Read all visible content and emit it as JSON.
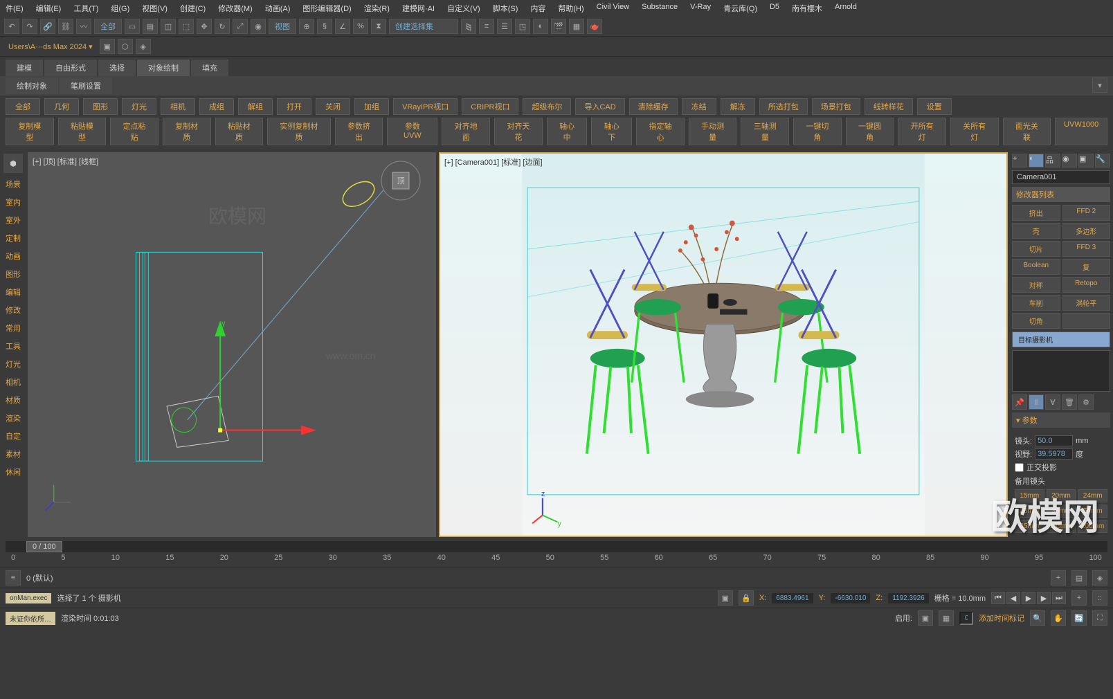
{
  "menu": [
    "件(E)",
    "编辑(E)",
    "工具(T)",
    "组(G)",
    "视图(V)",
    "创建(C)",
    "修改器(M)",
    "动画(A)",
    "图形编辑器(D)",
    "渲染(R)",
    "建模网·AI",
    "自定义(V)",
    "脚本(S)",
    "内容",
    "帮助(H)",
    "Civil View",
    "Substance",
    "V-Ray",
    "青云库(Q)",
    "D5",
    "南有樱木",
    "Arnold"
  ],
  "toolbar": {
    "dropdown": "全部",
    "viewLabel": "视图",
    "selectLabel": "创建选择集"
  },
  "pathbar": "Users\\A···ds Max 2024 ▾",
  "tabs": [
    "建模",
    "自由形式",
    "选择",
    "对象绘制",
    "填充"
  ],
  "subtabs": [
    "绘制对象",
    "笔刷设置"
  ],
  "scriptRows": [
    [
      "全部",
      "几何",
      "图形",
      "灯光",
      "相机",
      "成组",
      "解组",
      "打开",
      "关闭",
      "加组",
      "VRayIPR视口",
      "CRIPR视口",
      "超级布尔",
      "导入CAD",
      "清除缓存",
      "冻结",
      "解冻",
      "所选打包",
      "场景打包",
      "线转样花",
      "设置"
    ],
    [
      "复制模型",
      "粘贴模型",
      "定点粘贴",
      "复制材质",
      "粘贴材质",
      "实例复制材质",
      "参数挤出",
      "参数UVW",
      "对齐地面",
      "对齐天花",
      "轴心中",
      "轴心下",
      "指定轴心",
      "手动测量",
      "三轴测量",
      "一键切角",
      "一键圆角",
      "开所有灯",
      "关所有灯",
      "面光关联",
      "UVW1000"
    ]
  ],
  "sideLabels": [
    "场景",
    "室内",
    "室外",
    "定制",
    "动画",
    "图形",
    "编辑",
    "修改",
    "常用",
    "工具",
    "灯光",
    "相机",
    "材质",
    "渲染",
    "自定",
    "素材",
    "休闲"
  ],
  "viewport": {
    "leftLabel": "[+] [顶] [标准] [线框]",
    "rightLabel": "[+] [Camera001] [标准] [边面]",
    "wm": "欧模网",
    "wmUrl": "www.om.cn"
  },
  "rightPanel": {
    "objName": "Camera001",
    "modList": "修改器列表",
    "btns": [
      [
        "挤出",
        "FFD 2"
      ],
      [
        "壳",
        "多边形"
      ],
      [
        "切片",
        "FFD 3"
      ],
      [
        "Boolean",
        "复"
      ],
      [
        "对称",
        "Retopo"
      ],
      [
        "车削",
        "涡轮平"
      ],
      [
        "切角",
        ""
      ]
    ],
    "modifier": "目标摄影机",
    "paramsTitle": "参数",
    "lensLabel": "镜头:",
    "lensVal": "50.0",
    "lensUnit": "mm",
    "fovLabel": "视野:",
    "fovVal": "39.5978",
    "fovUnit": "度",
    "orthoLabel": "正交投影",
    "stockLabel": "备用镜头",
    "lenses": [
      "15mm",
      "20mm",
      "24mm",
      "28mm",
      "35mm",
      "50mm",
      "85mm",
      "135mm",
      "200mm"
    ]
  },
  "timeline": {
    "handle": "0 / 100",
    "ticks": [
      "0",
      "5",
      "10",
      "15",
      "20",
      "25",
      "30",
      "35",
      "40",
      "45",
      "50",
      "55",
      "60",
      "65",
      "70",
      "75",
      "80",
      "85",
      "90",
      "95",
      "100"
    ],
    "layer": "0 (默认)"
  },
  "status": {
    "script": "onMan.exec",
    "prompt": "未证你依所…",
    "selection": "选择了 1 个 摄影机",
    "renderTime": "渲染时间   0:01:03",
    "enable": "启用:",
    "x": "X:",
    "xv": "6883.4961",
    "y": "Y:",
    "yv": "-6630.010",
    "z": "Z:",
    "zv": "1192.3926",
    "grid": "栅格 = 10.0mm",
    "addTime": "添加时间标记"
  },
  "bigWatermark": "欧模网"
}
